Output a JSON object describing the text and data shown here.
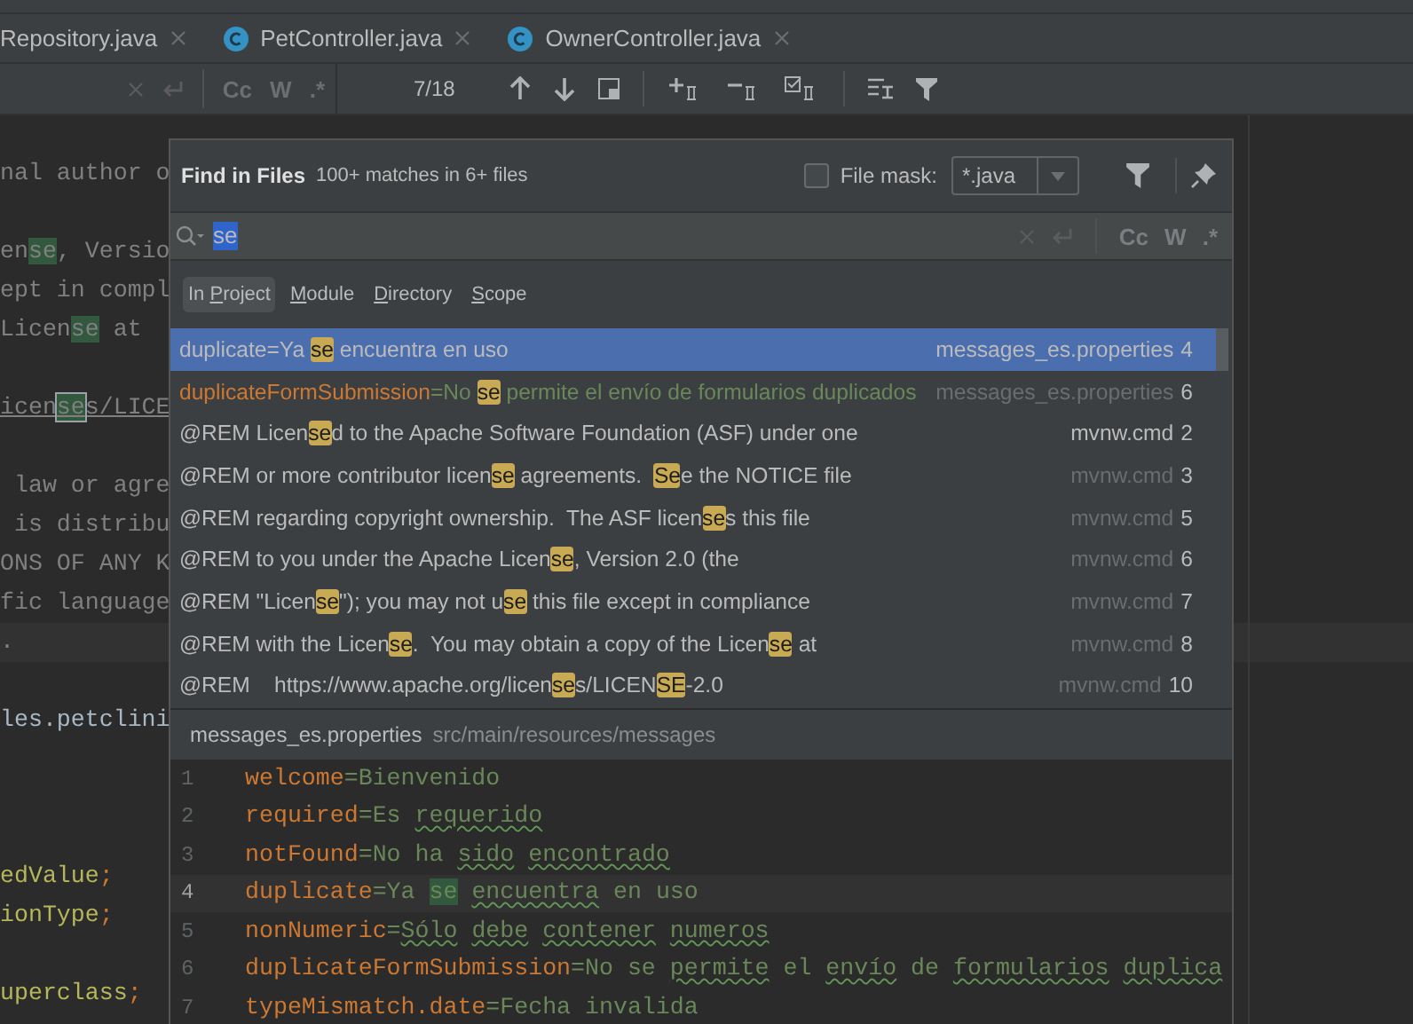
{
  "editor_tabs": [
    {
      "label": "Repository.java",
      "has_icon": false
    },
    {
      "label": "PetController.java",
      "has_icon": true
    },
    {
      "label": "OwnerController.java",
      "has_icon": true
    }
  ],
  "find_bar": {
    "match_count": "7/18",
    "options": [
      "Cc",
      "W",
      ".*"
    ]
  },
  "editor_lines": [
    {
      "kind": "blank"
    },
    {
      "kind": "code",
      "segments": [
        {
          "text": "nal author o",
          "kind": "comment"
        }
      ]
    },
    {
      "kind": "blank"
    },
    {
      "kind": "code",
      "segments": [
        {
          "text": "en",
          "kind": "comment"
        },
        {
          "text": "se",
          "kind": "match"
        },
        {
          "text": ", Versio",
          "kind": "comment"
        }
      ]
    },
    {
      "kind": "code",
      "segments": [
        {
          "text": "ept in compl",
          "kind": "comment"
        }
      ]
    },
    {
      "kind": "code",
      "segments": [
        {
          "text": "Licen",
          "kind": "comment"
        },
        {
          "text": "se",
          "kind": "match"
        },
        {
          "text": " at",
          "kind": "comment"
        }
      ]
    },
    {
      "kind": "blank"
    },
    {
      "kind": "code",
      "link": true,
      "segments": [
        {
          "text": "icen",
          "kind": "comment"
        },
        {
          "text": "se",
          "kind": "current_match"
        },
        {
          "text": "s/LICE",
          "kind": "comment"
        }
      ]
    },
    {
      "kind": "blank"
    },
    {
      "kind": "code",
      "segments": [
        {
          "text": " law or agre",
          "kind": "comment"
        }
      ]
    },
    {
      "kind": "code",
      "segments": [
        {
          "text": " is distribu",
          "kind": "comment"
        }
      ]
    },
    {
      "kind": "code",
      "segments": [
        {
          "text": "ONS OF ANY K",
          "kind": "comment"
        }
      ]
    },
    {
      "kind": "code",
      "segments": [
        {
          "text": "fic language",
          "kind": "comment"
        }
      ]
    },
    {
      "kind": "code",
      "current": true,
      "segments": [
        {
          "text": ".",
          "kind": "comment"
        }
      ]
    },
    {
      "kind": "blank"
    },
    {
      "kind": "code",
      "segments": [
        {
          "text": "les.petclini",
          "kind": "plain"
        }
      ]
    },
    {
      "kind": "blank"
    },
    {
      "kind": "blank"
    },
    {
      "kind": "blank"
    },
    {
      "kind": "code",
      "segments": [
        {
          "text": "edValue",
          "kind": "field"
        },
        {
          "text": ";",
          "kind": "punct"
        }
      ]
    },
    {
      "kind": "code",
      "segments": [
        {
          "text": "ionType",
          "kind": "field"
        },
        {
          "text": ";",
          "kind": "punct"
        }
      ]
    },
    {
      "kind": "blank"
    },
    {
      "kind": "code",
      "segments": [
        {
          "text": "uperclass",
          "kind": "field"
        },
        {
          "text": ";",
          "kind": "punct"
        }
      ]
    }
  ],
  "find_in_files": {
    "title": "Find in Files",
    "summary": "100+ matches in 6+ files",
    "file_mask": {
      "label": "File mask:",
      "checked": false,
      "value": "*.java"
    },
    "search": {
      "value": "se",
      "options": [
        "Cc",
        "W",
        ".*"
      ]
    },
    "scopes": [
      {
        "prefix": "In ",
        "mnemonic": "P",
        "rest": "roject",
        "selected": true
      },
      {
        "mnemonic": "M",
        "rest": "odule",
        "selected": false
      },
      {
        "mnemonic": "D",
        "rest": "irectory",
        "selected": false
      },
      {
        "mnemonic": "S",
        "rest": "cope",
        "selected": false
      }
    ],
    "results": [
      {
        "selected": true,
        "file": "messages_es.properties",
        "line": "4",
        "file_dimmed": false,
        "segments": [
          {
            "text": "duplicate=Ya ",
            "kind": "text"
          },
          {
            "text": "se",
            "kind": "match"
          },
          {
            "text": " encuentra en uso",
            "kind": "text"
          }
        ]
      },
      {
        "selected": false,
        "file": "messages_es.properties",
        "line": "6",
        "file_dimmed": true,
        "segments": [
          {
            "text": "duplicateFormSubmission",
            "kind": "key"
          },
          {
            "text": "=No ",
            "kind": "value"
          },
          {
            "text": "se",
            "kind": "match"
          },
          {
            "text": " permite el envío de formularios duplicados",
            "kind": "value"
          }
        ]
      },
      {
        "selected": false,
        "file": "mvnw.cmd",
        "line": "2",
        "file_dimmed": false,
        "segments": [
          {
            "text": "@REM Licen",
            "kind": "text"
          },
          {
            "text": "se",
            "kind": "match"
          },
          {
            "text": "d to the Apache Software Foundation (ASF) under one",
            "kind": "text"
          }
        ]
      },
      {
        "selected": false,
        "file": "mvnw.cmd",
        "line": "3",
        "file_dimmed": true,
        "segments": [
          {
            "text": "@REM or more contributor licen",
            "kind": "text"
          },
          {
            "text": "se",
            "kind": "match"
          },
          {
            "text": " agreements.  ",
            "kind": "text"
          },
          {
            "text": "Se",
            "kind": "match"
          },
          {
            "text": "e the NOTICE file",
            "kind": "text"
          }
        ]
      },
      {
        "selected": false,
        "file": "mvnw.cmd",
        "line": "5",
        "file_dimmed": true,
        "segments": [
          {
            "text": "@REM regarding copyright ownership.  The ASF licen",
            "kind": "text"
          },
          {
            "text": "se",
            "kind": "match"
          },
          {
            "text": "s this file",
            "kind": "text"
          }
        ]
      },
      {
        "selected": false,
        "file": "mvnw.cmd",
        "line": "6",
        "file_dimmed": true,
        "segments": [
          {
            "text": "@REM to you under the Apache Licen",
            "kind": "text"
          },
          {
            "text": "se",
            "kind": "match"
          },
          {
            "text": ", Version 2.0 (the",
            "kind": "text"
          }
        ]
      },
      {
        "selected": false,
        "file": "mvnw.cmd",
        "line": "7",
        "file_dimmed": true,
        "segments": [
          {
            "text": "@REM \"Licen",
            "kind": "text"
          },
          {
            "text": "se",
            "kind": "match"
          },
          {
            "text": "\"); you may not u",
            "kind": "text"
          },
          {
            "text": "se",
            "kind": "match"
          },
          {
            "text": " this file except in compliance",
            "kind": "text"
          }
        ]
      },
      {
        "selected": false,
        "file": "mvnw.cmd",
        "line": "8",
        "file_dimmed": true,
        "segments": [
          {
            "text": "@REM with the Licen",
            "kind": "text"
          },
          {
            "text": "se",
            "kind": "match"
          },
          {
            "text": ".  You may obtain a copy of the Licen",
            "kind": "text"
          },
          {
            "text": "se",
            "kind": "match"
          },
          {
            "text": " at",
            "kind": "text"
          }
        ]
      },
      {
        "selected": false,
        "file": "mvnw.cmd",
        "line": "10",
        "file_dimmed": true,
        "segments": [
          {
            "text": "@REM    https://www.apache.org/licen",
            "kind": "text"
          },
          {
            "text": "se",
            "kind": "match"
          },
          {
            "text": "s/LICEN",
            "kind": "text"
          },
          {
            "text": "SE",
            "kind": "match"
          },
          {
            "text": "-2.0",
            "kind": "text"
          }
        ]
      }
    ],
    "preview": {
      "file": "messages_es.properties",
      "path": "src/main/resources/messages",
      "lines": [
        {
          "number": "1",
          "current": false,
          "key": "welcome",
          "value": [
            {
              "text": "=Bienvenido",
              "kind": "text"
            }
          ]
        },
        {
          "number": "2",
          "current": false,
          "key": "required",
          "value": [
            {
              "text": "=Es ",
              "kind": "text"
            },
            {
              "text": "requerido",
              "kind": "typo"
            }
          ]
        },
        {
          "number": "3",
          "current": false,
          "key": "notFound",
          "value": [
            {
              "text": "=No ha ",
              "kind": "text"
            },
            {
              "text": "sido",
              "kind": "typo"
            },
            {
              "text": " encontrado",
              "kind": "typo"
            }
          ]
        },
        {
          "number": "4",
          "current": true,
          "key": "duplicate",
          "value": [
            {
              "text": "=Ya ",
              "kind": "text"
            },
            {
              "text": "se",
              "kind": "match"
            },
            {
              "text": " encuentra",
              "kind": "typo"
            },
            {
              "text": " en uso",
              "kind": "text"
            }
          ]
        },
        {
          "number": "5",
          "current": false,
          "key": "nonNumeric",
          "value": [
            {
              "text": "=",
              "kind": "text"
            },
            {
              "text": "Sólo",
              "kind": "typo"
            },
            {
              "text": " debe",
              "kind": "typo"
            },
            {
              "text": " contener",
              "kind": "typo"
            },
            {
              "text": " numeros",
              "kind": "typo"
            }
          ]
        },
        {
          "number": "6",
          "current": false,
          "key": "duplicateFormSubmission",
          "value": [
            {
              "text": "=No se ",
              "kind": "text"
            },
            {
              "text": "permite",
              "kind": "typo"
            },
            {
              "text": " el ",
              "kind": "text"
            },
            {
              "text": "envío",
              "kind": "typo"
            },
            {
              "text": " de ",
              "kind": "text"
            },
            {
              "text": "formularios",
              "kind": "typo"
            },
            {
              "text": " duplica",
              "kind": "typo"
            }
          ]
        },
        {
          "number": "7",
          "current": false,
          "key": "typeMismatch.date",
          "value": [
            {
              "text": "=Fecha invalida",
              "kind": "text"
            }
          ]
        }
      ]
    }
  }
}
